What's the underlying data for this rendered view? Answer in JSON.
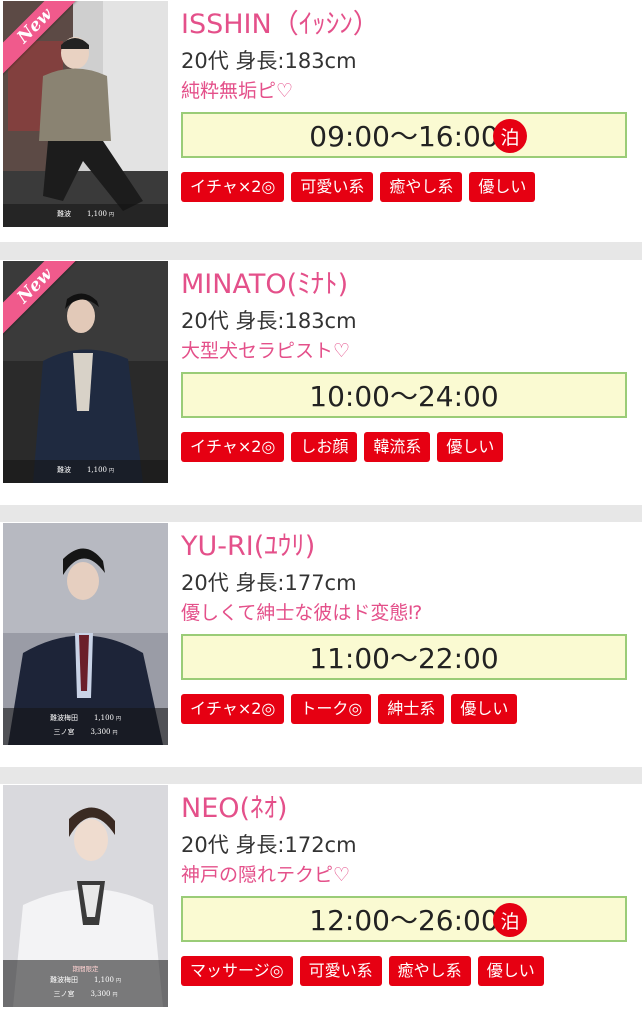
{
  "colors": {
    "name": "#e4508a",
    "catchphrase": "#e4508a",
    "tag_bg": "#e60012",
    "hours_bg": "#fafad2",
    "hours_border": "#9acc77",
    "new_ribbon": "#f05a8c"
  },
  "therapists": [
    {
      "name": "ISSHIN（ｲｯｼﾝ）",
      "stats": "20代 身長:183cm",
      "catchphrase": "純粋無垢ピ♡",
      "hours": "09:00〜16:00",
      "overnight_badge": "泊",
      "new_badge": "New",
      "prices": [
        {
          "area": "難波",
          "price": "1,100",
          "unit": "円"
        }
      ],
      "tags": [
        "イチャ×2◎",
        "可愛い系",
        "癒やし系",
        "優しい"
      ]
    },
    {
      "name": "MINATO(ﾐﾅﾄ)",
      "stats": "20代 身長:183cm",
      "catchphrase": "大型犬セラピスト♡",
      "hours": "10:00〜24:00",
      "new_badge": "New",
      "prices": [
        {
          "area": "難波",
          "price": "1,100",
          "unit": "円"
        }
      ],
      "tags": [
        "イチャ×2◎",
        "しお顔",
        "韓流系",
        "優しい"
      ]
    },
    {
      "name": "YU-RI(ﾕｳﾘ)",
      "stats": "20代 身長:177cm",
      "catchphrase": "優しくて紳士な彼はド変態⁉",
      "hours": "11:00〜22:00",
      "prices": [
        {
          "area": "難波梅田",
          "price": "1,100",
          "unit": "円"
        },
        {
          "area": "三ノ宮",
          "price": "3,300",
          "unit": "円"
        }
      ],
      "tags": [
        "イチャ×2◎",
        "トーク◎",
        "紳士系",
        "優しい"
      ]
    },
    {
      "name": "NEO(ﾈｵ)",
      "stats": "20代 身長:172cm",
      "catchphrase": "神戸の隠れテクピ♡",
      "hours": "12:00〜26:00",
      "overnight_badge": "泊",
      "limited_label": "期間限定",
      "prices": [
        {
          "area": "難波梅田",
          "price": "1,100",
          "unit": "円"
        },
        {
          "area": "三ノ宮",
          "price": "3,300",
          "unit": "円"
        }
      ],
      "tags": [
        "マッサージ◎",
        "可愛い系",
        "癒やし系",
        "優しい"
      ]
    }
  ]
}
